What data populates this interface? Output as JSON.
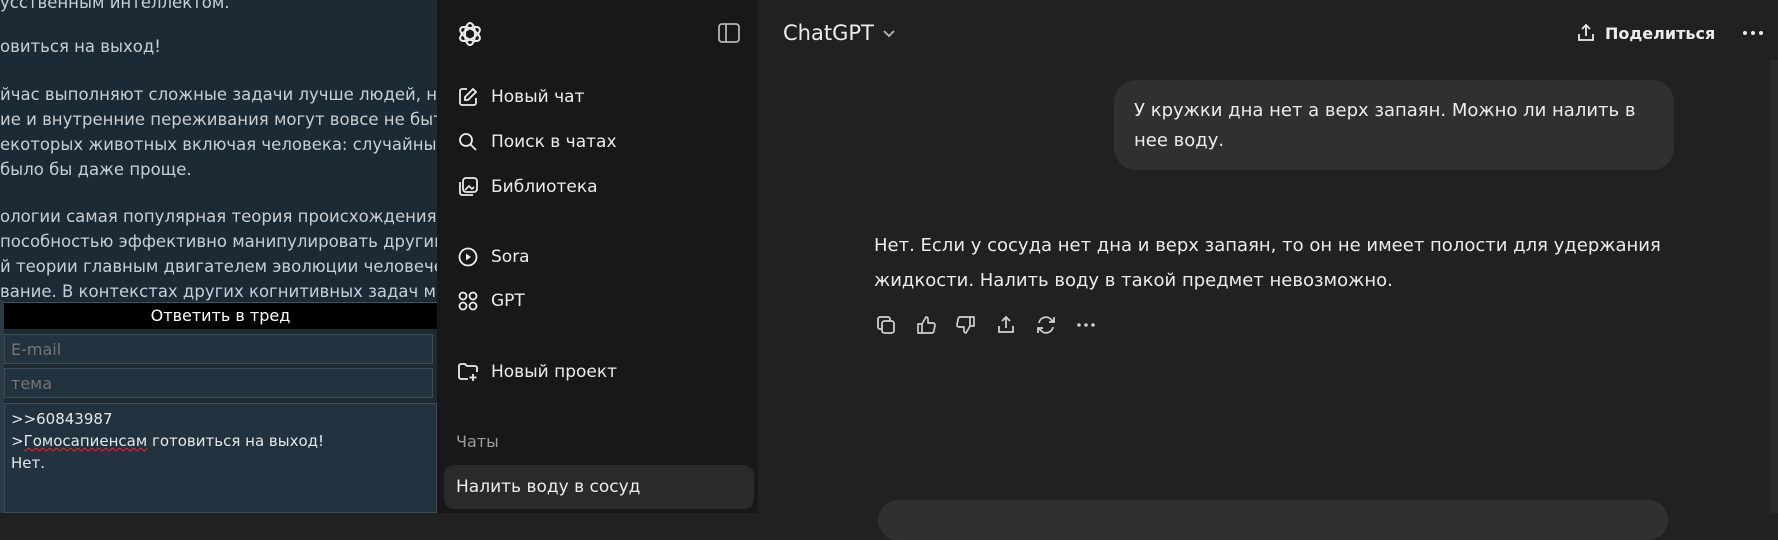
{
  "background_page": {
    "lines": [
      "усственным интеллектом.",
      "овиться на выход!",
      "йчас выполняют сложные задачи лучше людей, но",
      "ие и внутренние переживания могут вовсе не быть",
      "екоторых животных включая человека: случайный",
      " было бы даже проще.",
      "ологии самая популярная теория происхождения ч",
      "пособностью эффективно манипулировать другим",
      "й теории главным двигателем эволюции человече",
      "вание. В контекстах других когнитивных задач мы"
    ],
    "reply_button": "Ответить в тред",
    "email_placeholder": "E-mail",
    "subject_placeholder": "тема",
    "reply_lines": {
      "quote_link": ">>60843987",
      "quote_prefix": ">",
      "quote_word": "Гомосапиенсам",
      "quote_rest": " готовиться на выход!",
      "answer": "Нет."
    }
  },
  "sidebar": {
    "items": [
      {
        "label": "Новый чат",
        "icon": "edit-icon"
      },
      {
        "label": "Поиск в чатах",
        "icon": "search-icon"
      },
      {
        "label": "Библиотека",
        "icon": "library-icon"
      },
      {
        "label": "Sora",
        "icon": "play-circle-icon"
      },
      {
        "label": "GPT",
        "icon": "grid-icon"
      },
      {
        "label": "Новый проект",
        "icon": "folder-plus-icon"
      }
    ],
    "chats_heading": "Чаты",
    "chats": [
      {
        "title": "Налить воду в сосуд",
        "active": true
      }
    ]
  },
  "header": {
    "model_name": "ChatGPT",
    "share_label": "Поделиться"
  },
  "conversation": {
    "user_message": "У кружки дна нет а верх запаян. Можно ли налить в нее воду.",
    "assistant_message": "Нет. Если у сосуда нет дна и верх запаян, то он не имеет полости для удержания жидкости. Налить воду в такой предмет невозможно.",
    "actions": [
      "copy-icon",
      "thumbs-up-icon",
      "thumbs-down-icon",
      "share-icon",
      "regenerate-icon",
      "more-icon"
    ]
  },
  "colors": {
    "main_bg": "#212121",
    "sidebar_bg": "#181818",
    "bubble_bg": "#303030",
    "text": "#ececec",
    "muted": "#9b9b9b",
    "forum_bg": "#1c2a35"
  }
}
